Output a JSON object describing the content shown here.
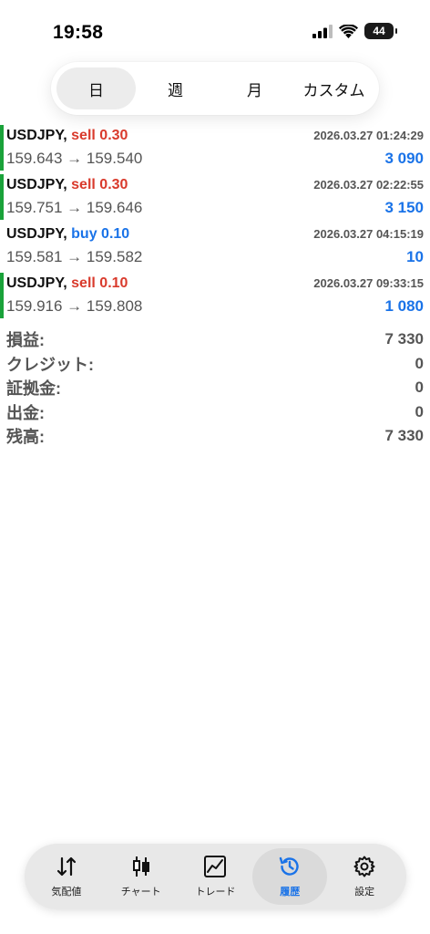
{
  "status": {
    "time": "19:58",
    "battery": "44"
  },
  "periods": [
    {
      "label": "日",
      "active": true
    },
    {
      "label": "週",
      "active": false
    },
    {
      "label": "月",
      "active": false
    },
    {
      "label": "カスタム",
      "active": false
    }
  ],
  "deals": [
    {
      "symbol": "USDJPY,",
      "side": "sell 0.30",
      "time": "2026.03.27 01:24:29",
      "prices": "159.643 → 159.540",
      "profit": "3 090"
    },
    {
      "symbol": "USDJPY,",
      "side": "sell 0.30",
      "time": "2026.03.27 02:22:55",
      "prices": "159.751 → 159.646",
      "profit": "3 150"
    },
    {
      "symbol": "USDJPY,",
      "side": "buy 0.10",
      "time": "2026.03.27 04:15:19",
      "prices": "159.581 → 159.582",
      "profit": "10"
    },
    {
      "symbol": "USDJPY,",
      "side": "sell 0.10",
      "time": "2026.03.27 09:33:15",
      "prices": "159.916 → 159.808",
      "profit": "1 080"
    }
  ],
  "summary": [
    {
      "label": "損益:",
      "value": "7 330"
    },
    {
      "label": "クレジット:",
      "value": "0"
    },
    {
      "label": "証拠金:",
      "value": "0"
    },
    {
      "label": "出金:",
      "value": "0"
    },
    {
      "label": "残高:",
      "value": "7 330"
    }
  ],
  "nav": [
    {
      "label": "気配値",
      "icon": "quotes-arrows-icon"
    },
    {
      "label": "チャート",
      "icon": "candlestick-chart-icon"
    },
    {
      "label": "トレード",
      "icon": "trade-line-chart-icon"
    },
    {
      "label": "履歴",
      "icon": "history-clock-icon",
      "active": true
    },
    {
      "label": "設定",
      "icon": "gear-icon"
    }
  ],
  "colors": {
    "sell": "#d93a2c",
    "buy": "#1a73e8",
    "profit": "#1a73e8",
    "marker": "#1aa23a"
  }
}
